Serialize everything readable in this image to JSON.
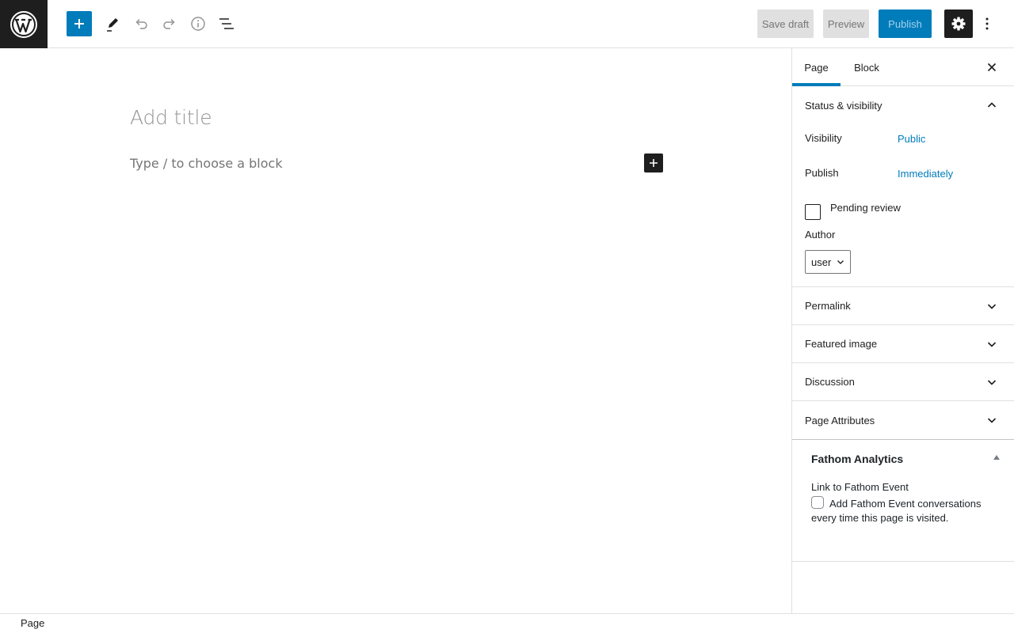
{
  "header": {
    "logo_icon": "wordpress-logo-icon",
    "tools": [
      "add-block-icon",
      "edit-pencil-icon",
      "undo-icon",
      "redo-icon",
      "info-icon",
      "list-view-icon"
    ],
    "save_draft_label": "Save draft",
    "preview_label": "Preview",
    "publish_label": "Publish",
    "settings_icon": "gear-icon",
    "more_icon": "more-vertical-icon"
  },
  "editor": {
    "title_placeholder": "Add title",
    "block_placeholder": "Type / to choose a block"
  },
  "sidebar": {
    "tabs": [
      {
        "label": "Page",
        "active": true
      },
      {
        "label": "Block",
        "active": false
      }
    ],
    "status_visibility": {
      "title": "Status & visibility",
      "visibility_label": "Visibility",
      "visibility_value": "Public",
      "publish_label": "Publish",
      "publish_value": "Immediately",
      "pending_review_label": "Pending review",
      "author_label": "Author",
      "author_value": "user"
    },
    "panels": [
      {
        "title": "Permalink"
      },
      {
        "title": "Featured image"
      },
      {
        "title": "Discussion"
      },
      {
        "title": "Page Attributes"
      }
    ],
    "fathom": {
      "title": "Fathom Analytics",
      "link_label": "Link to Fathom Event",
      "checkbox_label": "Add Fathom Event conversations every time this page is visited."
    }
  },
  "footer": {
    "breadcrumb": "Page"
  },
  "colors": {
    "accent": "#007cba",
    "dark": "#1e1e1e",
    "border": "#e0e0e0"
  }
}
